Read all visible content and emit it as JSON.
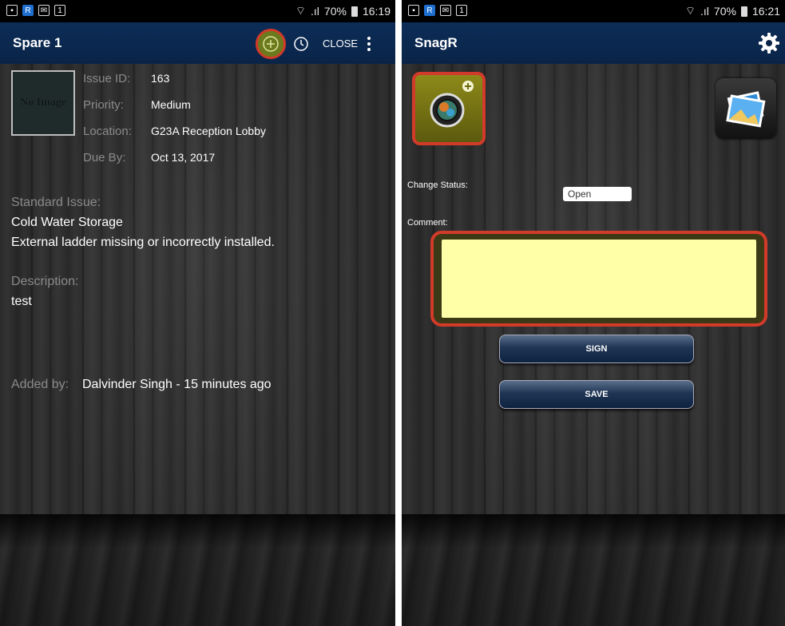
{
  "left": {
    "status": {
      "signal": "70%",
      "time": "16:19"
    },
    "title": "Spare 1",
    "actions": {
      "close_label": "CLOSE"
    },
    "thumbnail_text": "No Image",
    "fields": [
      {
        "label": "Issue ID:",
        "value": "163"
      },
      {
        "label": "Priority:",
        "value": "Medium"
      },
      {
        "label": "Location:",
        "value": "G23A Reception Lobby"
      },
      {
        "label": "Due By:",
        "value": "Oct 13, 2017"
      }
    ],
    "standard_issue": {
      "label": "Standard Issue:",
      "line1": "Cold Water Storage",
      "line2": "External ladder missing or incorrectly installed."
    },
    "description": {
      "label": "Description:",
      "value": "test"
    },
    "added_by": {
      "label": "Added by:",
      "value": "Dalvinder Singh - 15 minutes ago"
    }
  },
  "right": {
    "status": {
      "signal": "70%",
      "time": "16:21"
    },
    "title": "SnagR",
    "change_status_label": "Change Status:",
    "status_value": "Open",
    "comment_label": "Comment:",
    "comment_value": "",
    "sign_label": "SIGN",
    "save_label": "SAVE"
  },
  "colors": {
    "appbar": "#0a2447",
    "highlight": "#d23a2a",
    "comment_bg": "#ffffa8",
    "add_button": "#6b7a1c"
  },
  "icons": [
    "gallery-icon",
    "sms-icon",
    "calendar-icon",
    "wifi-icon",
    "battery-icon",
    "add-circle-icon",
    "clock-icon",
    "more-vert-icon",
    "gear-icon",
    "camera-icon",
    "photos-icon"
  ]
}
